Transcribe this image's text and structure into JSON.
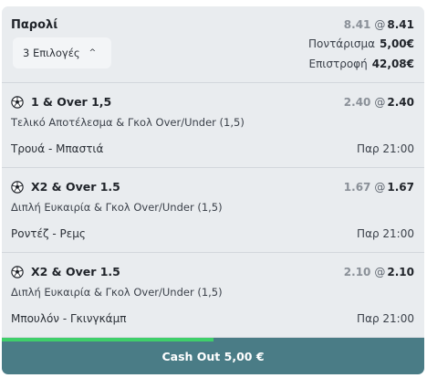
{
  "header": {
    "title": "Παρολί",
    "old_odds": "8.41",
    "at": "@",
    "new_odds": "8.41",
    "picks_label": "3 Επιλογές",
    "picks_chevron": "^",
    "stake_label": "Ποντάρισμα",
    "stake_value": "5,00€",
    "return_label": "Επιστροφή",
    "return_value": "42,08€"
  },
  "selections": [
    {
      "name": "1 & Over 1,5",
      "old_odds": "2.40",
      "at": "@",
      "new_odds": "2.40",
      "market": "Τελικό Αποτέλεσμα & Γκολ Over/Under (1,5)",
      "event": "Τρουά - Μπαστιά",
      "time": "Παρ 21:00"
    },
    {
      "name": "X2 & Over 1.5",
      "old_odds": "1.67",
      "at": "@",
      "new_odds": "1.67",
      "market": "Διπλή Ευκαιρία & Γκολ Over/Under (1,5)",
      "event": "Ροντέζ - Ρεμς",
      "time": "Παρ 21:00"
    },
    {
      "name": "X2 & Over 1.5",
      "old_odds": "2.10",
      "at": "@",
      "new_odds": "2.10",
      "market": "Διπλή Ευκαιρία & Γκολ Over/Under (1,5)",
      "event": "Μπουλόν - Γκινγκάμπ",
      "time": "Παρ 21:00"
    }
  ],
  "cashout": {
    "label": "Cash Out 5,00 €",
    "progress_fraction": 0.5
  },
  "icons": {
    "sport": "soccer-ball-icon",
    "chevron": "chevron-up-icon"
  },
  "colors": {
    "cashout_bg": "#4a7c86",
    "progress": "#3fcf6a",
    "card_bg": "#e9ecef"
  }
}
